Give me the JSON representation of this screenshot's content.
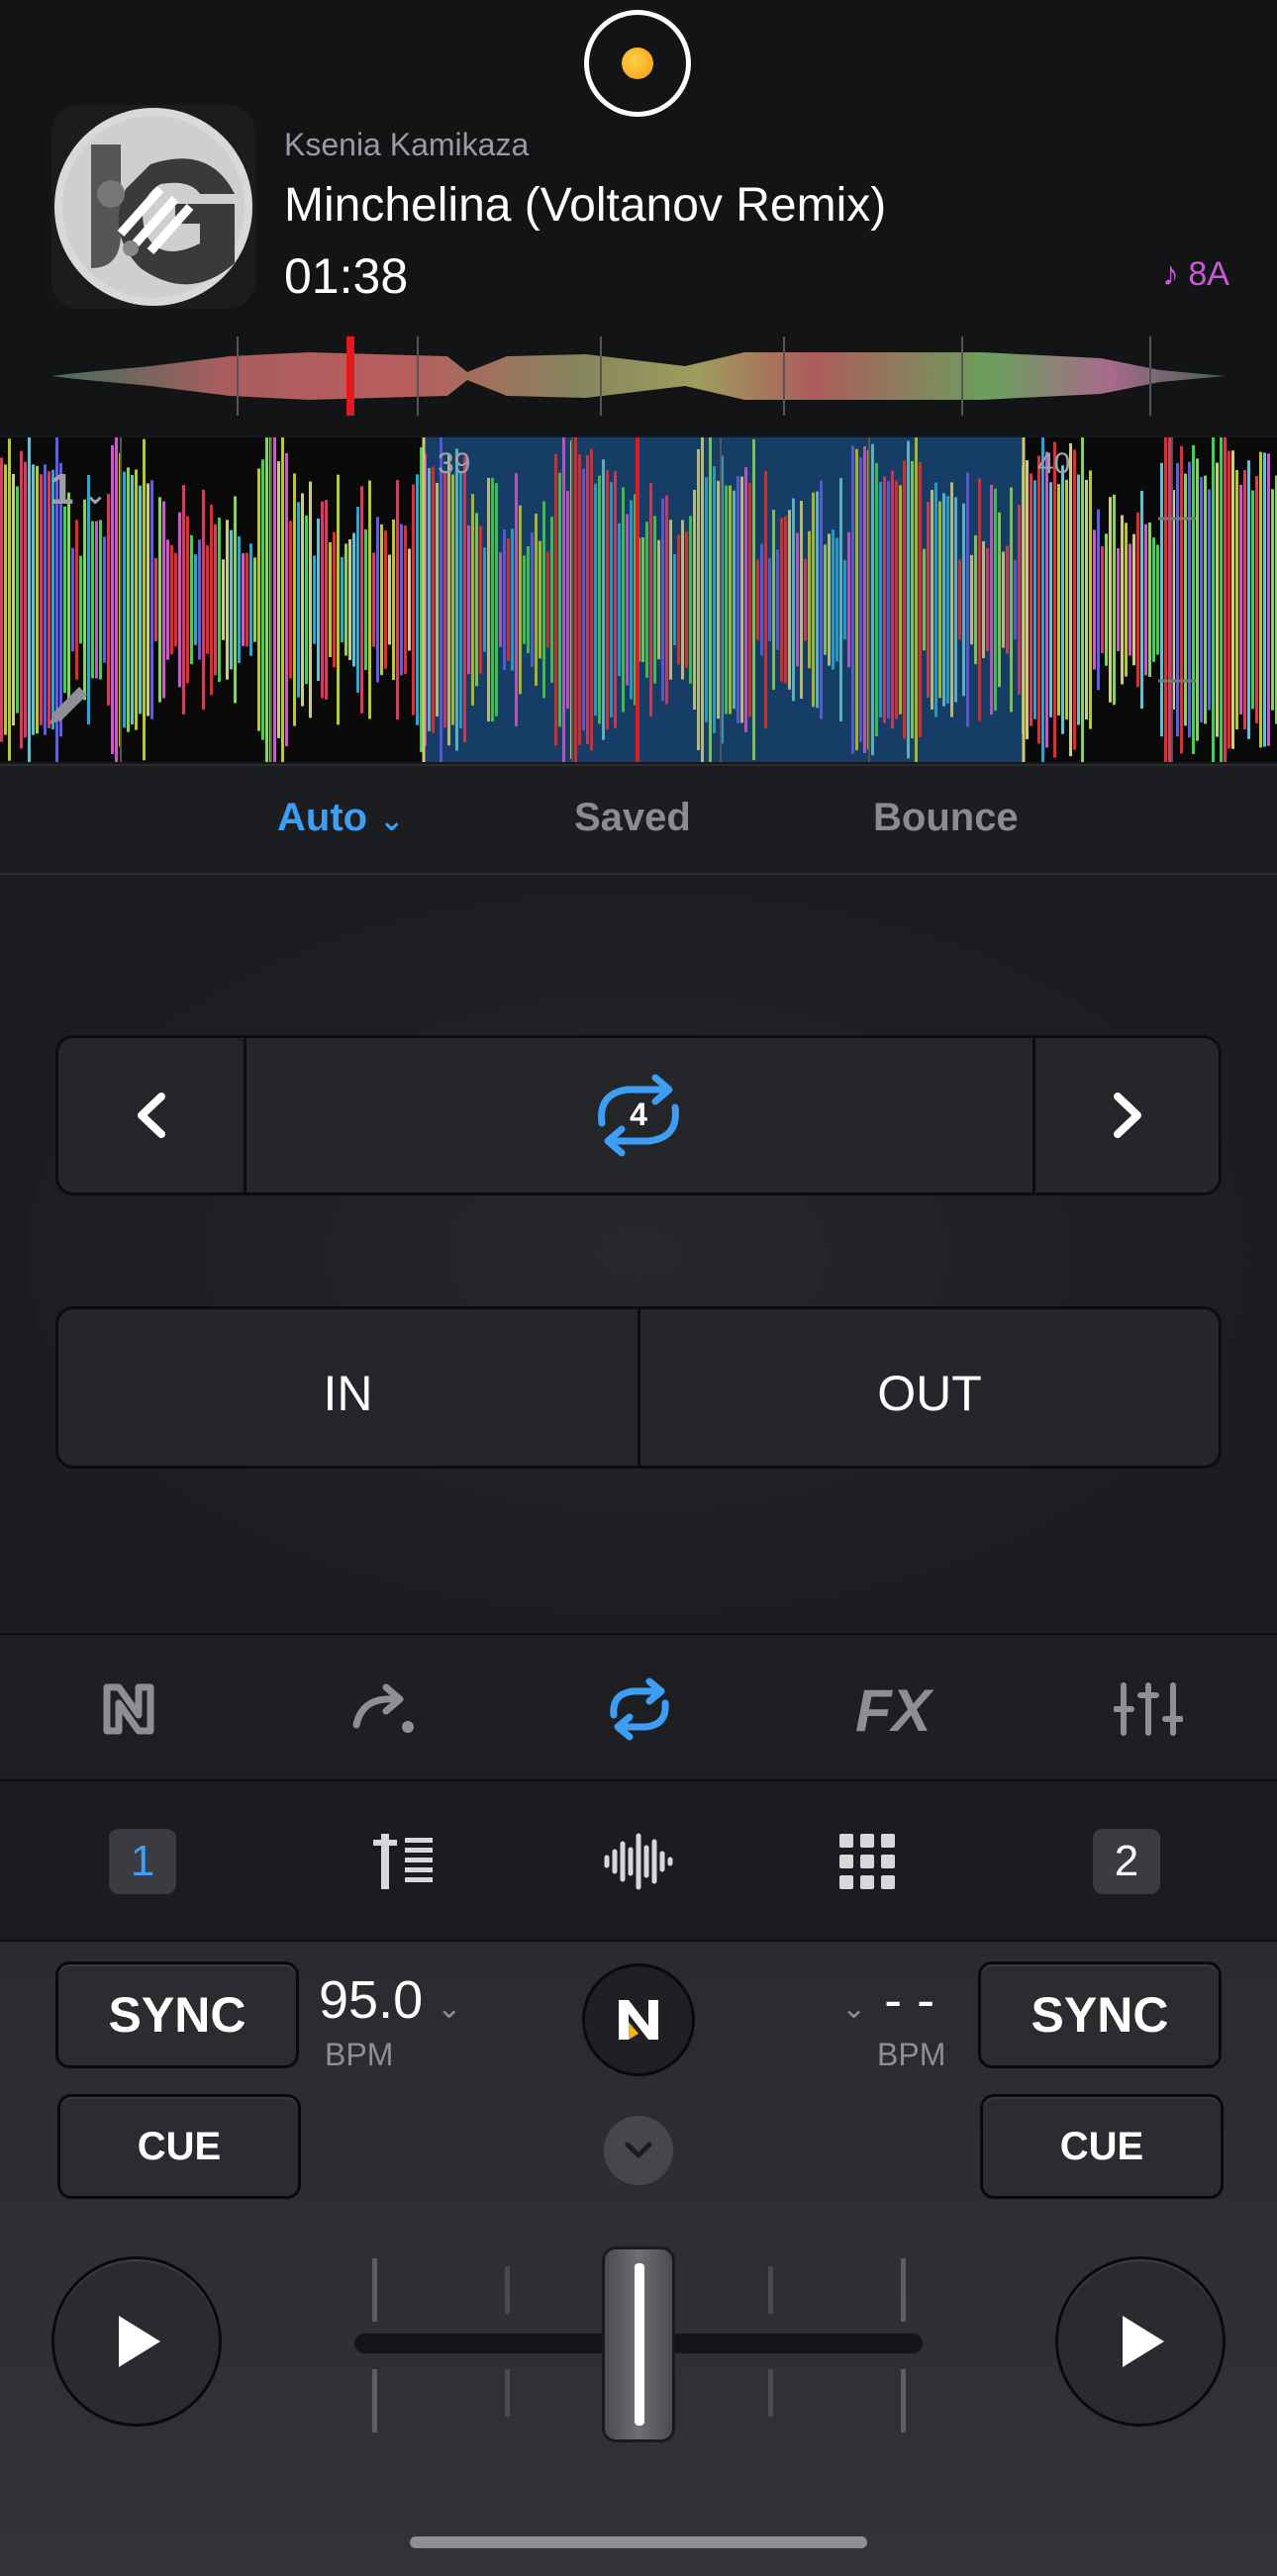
{
  "track": {
    "artist": "Ksenia Kamikaza",
    "title": "Minchelina (Voltanov Remix)",
    "time": "01:38",
    "key": "♪ 8A"
  },
  "waveform": {
    "deck_number": "1",
    "beat_markers": [
      "39",
      "40"
    ]
  },
  "loop_tabs": [
    {
      "label": "Auto",
      "active": true
    },
    {
      "label": "Saved",
      "active": false
    },
    {
      "label": "Bounce",
      "active": false
    }
  ],
  "loop": {
    "size": "4",
    "in_label": "IN",
    "out_label": "OUT"
  },
  "modes": [
    "djay-logo-icon",
    "redo-arrow-icon",
    "loop-icon",
    "fx-icon",
    "mixer-sliders-icon"
  ],
  "view_bar": {
    "deck_left": "1",
    "deck_right": "2"
  },
  "mixer": {
    "left": {
      "sync": "SYNC",
      "cue": "CUE",
      "bpm_value": "95.0",
      "bpm_label": "BPM"
    },
    "right": {
      "sync": "SYNC",
      "cue": "CUE",
      "bpm_value": "- -",
      "bpm_label": "BPM"
    }
  },
  "colors": {
    "accent": "#3d9ef5",
    "key": "#c55cd6",
    "playhead": "#e3191b",
    "loop_region": "#163d66"
  }
}
